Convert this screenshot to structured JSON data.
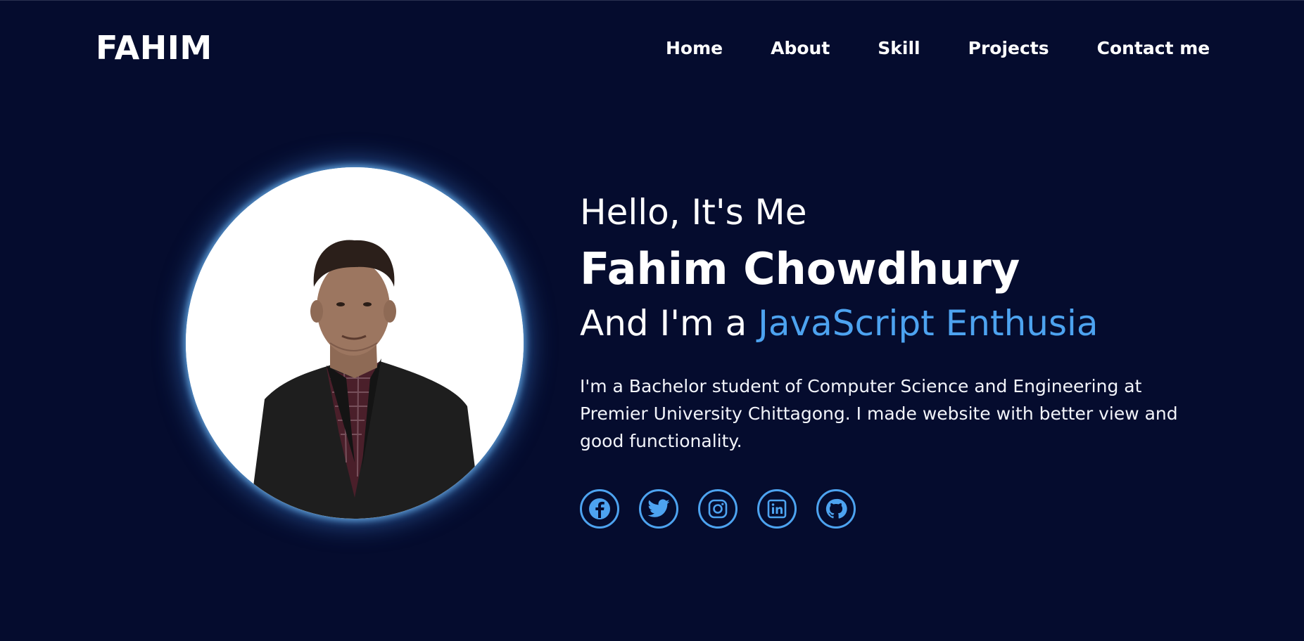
{
  "brand": {
    "logo_text": "FAHIM"
  },
  "nav": {
    "items": [
      {
        "label": "Home"
      },
      {
        "label": "About"
      },
      {
        "label": "Skill"
      },
      {
        "label": "Projects"
      },
      {
        "label": "Contact me"
      }
    ]
  },
  "hero": {
    "greeting": "Hello, It's Me",
    "name": "Fahim Chowdhury",
    "role_prefix": "And I'm a ",
    "role_highlight": "JavaScript Enthusia",
    "bio": "I'm a Bachelor student of Computer Science and Engineering at Premier University Chittagong. I made website with better view and good functionality.",
    "photo_icon": "profile-photo"
  },
  "socials": [
    {
      "icon": "facebook-icon"
    },
    {
      "icon": "twitter-icon"
    },
    {
      "icon": "instagram-icon"
    },
    {
      "icon": "linkedin-icon"
    },
    {
      "icon": "github-icon"
    }
  ],
  "colors": {
    "background": "#050c2e",
    "accent": "#4da3f0",
    "text": "#ffffff"
  }
}
